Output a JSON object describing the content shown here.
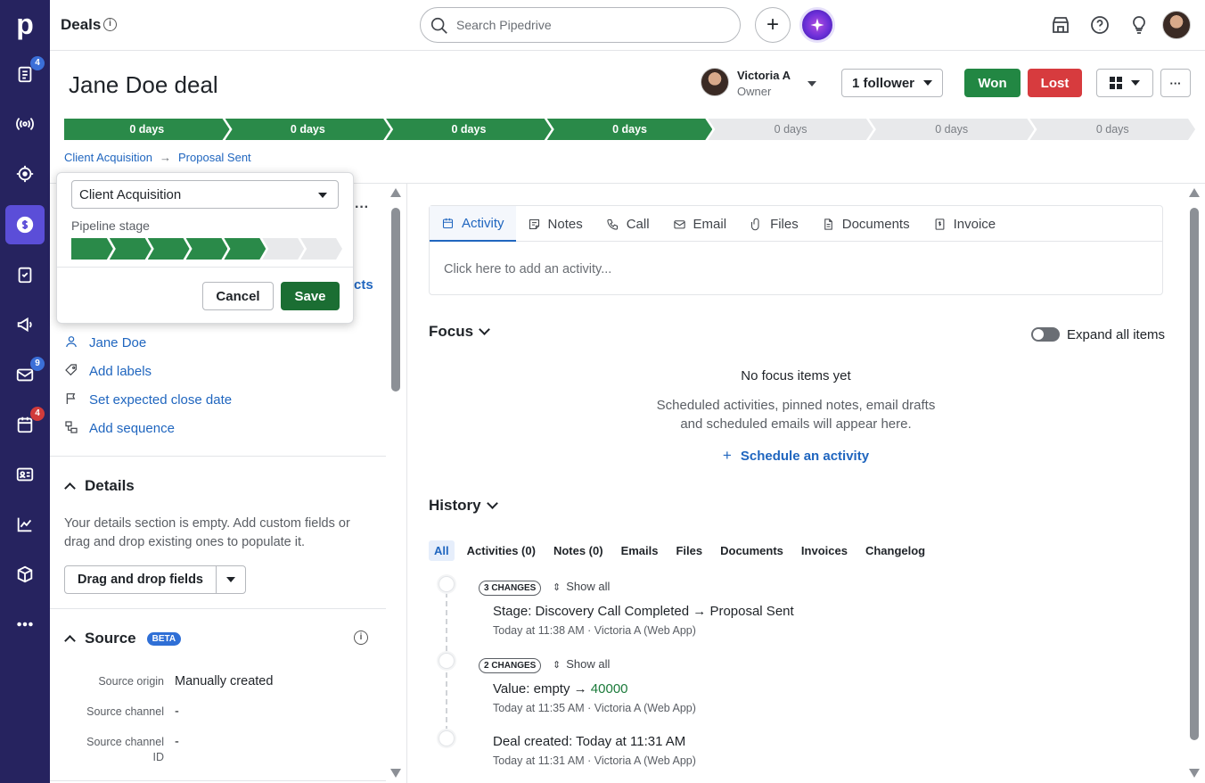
{
  "nav": {
    "logo": "p",
    "badges": {
      "activities": "4",
      "mail": "9",
      "calendar": "4"
    },
    "items": [
      "deals-list",
      "leads",
      "projects",
      "deals",
      "tasks",
      "campaigns",
      "mail",
      "calendar",
      "contacts",
      "insights",
      "products",
      "more"
    ]
  },
  "topbar": {
    "title": "Deals",
    "search_placeholder": "Search Pipedrive",
    "add_label": "+"
  },
  "deal": {
    "title": "Jane Doe deal",
    "owner_name": "Victoria A",
    "owner_role": "Owner",
    "follower_label": "1 follower",
    "won_label": "Won",
    "lost_label": "Lost",
    "more_label": "···"
  },
  "stages": [
    {
      "label": "0 days",
      "done": true
    },
    {
      "label": "0 days",
      "done": true
    },
    {
      "label": "0 days",
      "done": true
    },
    {
      "label": "0 days",
      "done": true
    },
    {
      "label": "0 days",
      "done": false
    },
    {
      "label": "0 days",
      "done": false
    },
    {
      "label": "0 days",
      "done": false
    }
  ],
  "pipeline_crumb": {
    "pipeline": "Client Acquisition",
    "arrow": "→",
    "stage": "Proposal Sent"
  },
  "popover": {
    "pipeline_value": "Client Acquisition",
    "stage_label": "Pipeline stage",
    "stages_total": 7,
    "stages_selected": 5,
    "cancel_label": "Cancel",
    "save_label": "Save"
  },
  "left": {
    "menu_peek": "···",
    "contacts_peek": "cts",
    "links": {
      "person": "Jane Doe",
      "labels": "Add labels",
      "close_date": "Set expected close date",
      "sequence": "Add sequence"
    },
    "details": {
      "title": "Details",
      "empty_text": "Your details section is empty. Add custom fields or drag and drop existing ones to populate it.",
      "drag_label": "Drag and drop fields"
    },
    "source": {
      "title": "Source",
      "beta": "BETA",
      "origin_label": "Source origin",
      "origin_value": "Manually created",
      "channel_label": "Source channel",
      "channel_value": "-",
      "channel_id_label": "Source channel ID",
      "channel_id_value": "-"
    }
  },
  "tabs": {
    "items": [
      "Activity",
      "Notes",
      "Call",
      "Email",
      "Files",
      "Documents",
      "Invoice"
    ],
    "activity_placeholder": "Click here to add an activity..."
  },
  "focus": {
    "title": "Focus",
    "expand_label": "Expand all items",
    "empty_title": "No focus items yet",
    "empty_text_1": "Scheduled activities, pinned notes, email drafts",
    "empty_text_2": "and scheduled emails will appear here.",
    "schedule_label": "Schedule an activity"
  },
  "history": {
    "title": "History",
    "tabs": [
      "All",
      "Activities (0)",
      "Notes (0)",
      "Emails",
      "Files",
      "Documents",
      "Invoices",
      "Changelog"
    ],
    "entries": [
      {
        "changes": "3 CHANGES",
        "show_all": "Show all",
        "field": "Stage",
        "text": "Discovery Call Completed → Proposal Sent",
        "meta": "Today at 11:38 AM · Victoria A (Web App)"
      },
      {
        "changes": "2 CHANGES",
        "show_all": "Show all",
        "field": "Value",
        "text": "empty →",
        "value": "40000",
        "meta": "Today at 11:35 AM · Victoria A (Web App)"
      },
      {
        "field": "Deal created",
        "text": "Today at 11:31 AM",
        "meta": "Today at 11:31 AM · Victoria A (Web App)"
      }
    ]
  }
}
